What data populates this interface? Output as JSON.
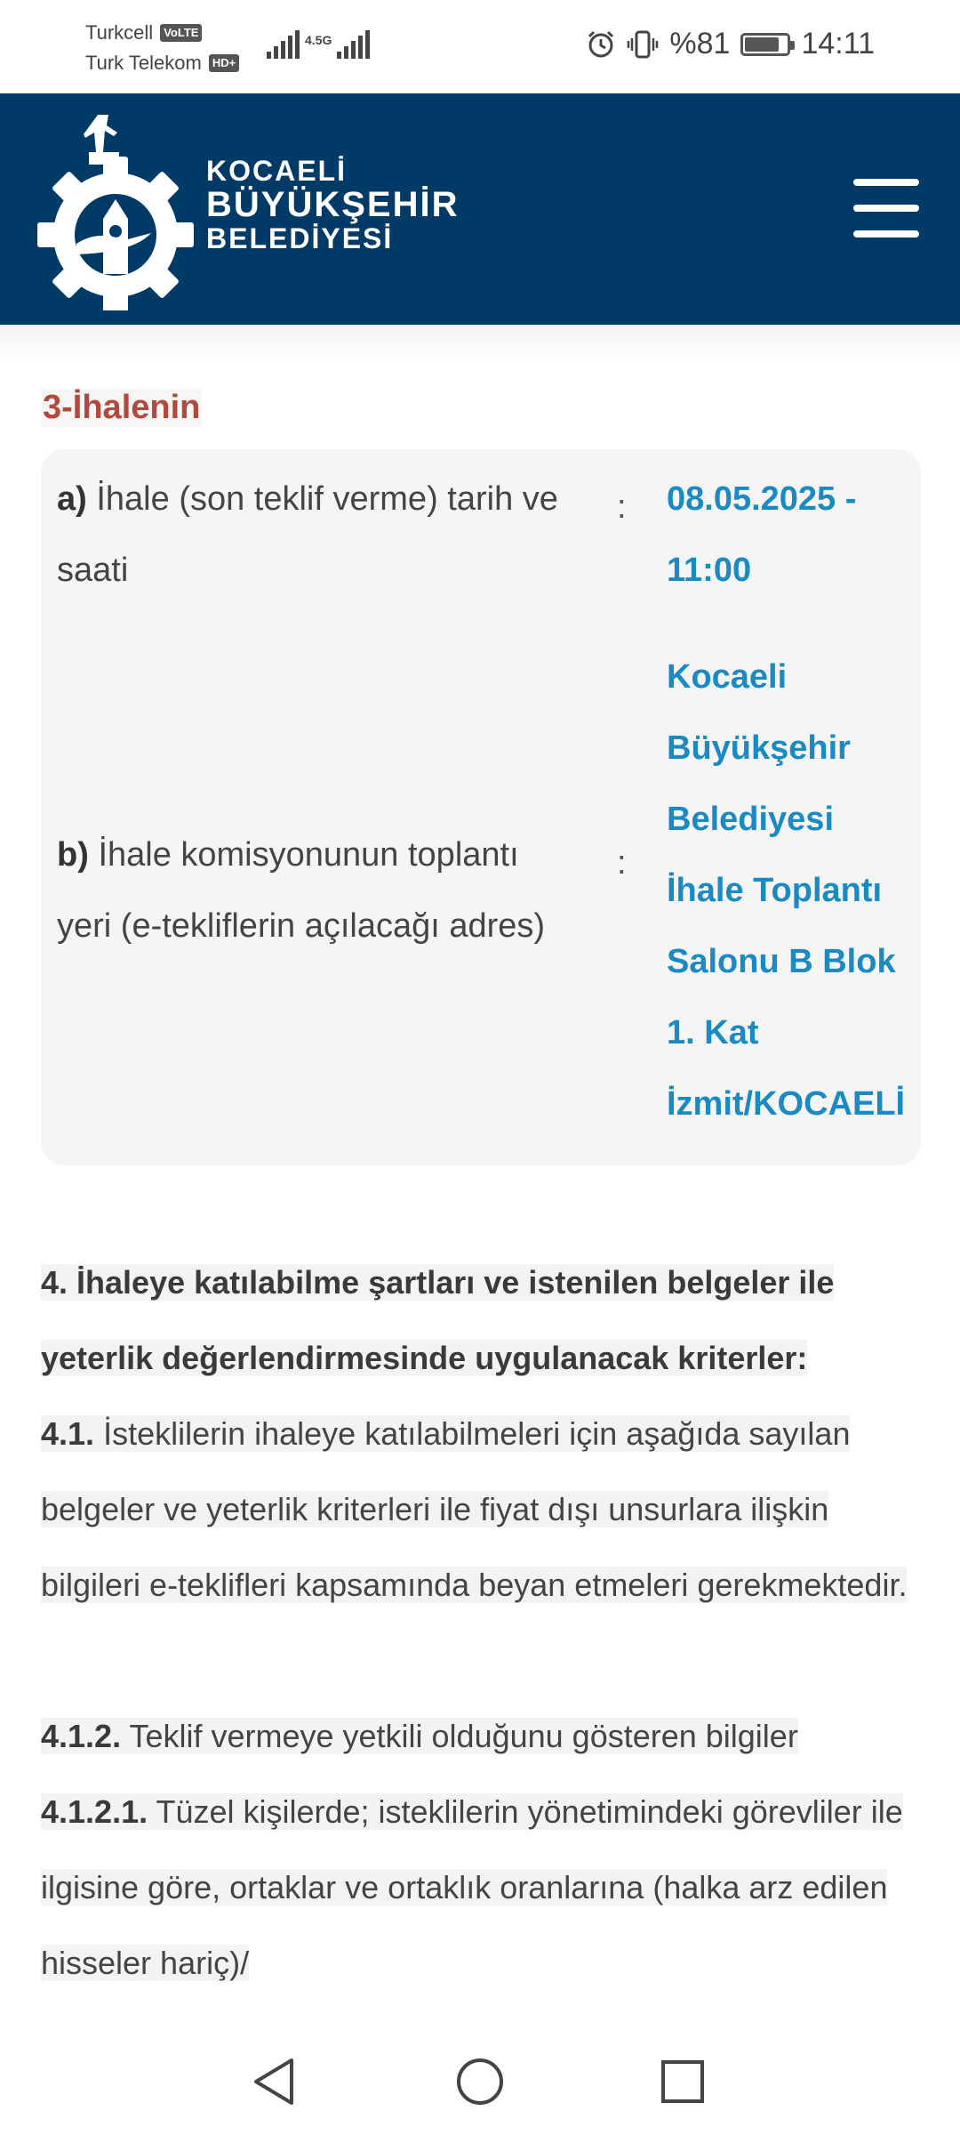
{
  "status_bar": {
    "carrier1": "Turkcell",
    "carrier1_tag": "VoLTE",
    "carrier2": "Turk Telekom",
    "carrier2_tag": "HD+",
    "network": "4.5G",
    "battery_text": "%81",
    "battery_level_percent": 81,
    "time": "14:11"
  },
  "header": {
    "brand_line1": "KOCAELİ",
    "brand_line2": "BÜYÜKŞEHİR",
    "brand_line3": "BELEDİYESİ",
    "logo_icon": "kocaeli-logo-icon",
    "menu_icon": "hamburger-menu-icon",
    "colors": {
      "background": "#003a66",
      "accent_title": "#b14a3c",
      "value_blue": "#1b8ac2"
    }
  },
  "section": {
    "title": "3-İhalenin",
    "rows": [
      {
        "key": "a)",
        "label": "İhale (son teklif verme) tarih ve saati",
        "colon": ":",
        "value": "08.05.2025 - 11:00"
      },
      {
        "key": "b)",
        "label": "İhale komisyonunun toplantı yeri (e-tekliflerin açılacağı adres)",
        "colon": ":",
        "value": "Kocaeli Büyükşehir Belediyesi İhale Toplantı Salonu B Blok 1. Kat İzmit/KOCAELİ"
      }
    ]
  },
  "body": {
    "p4_title": "4. İhaleye katılabilme şartları ve istenilen belgeler ile yeterlik değerlendirmesinde uygulanacak kriterler:",
    "p41_num": "4.1.",
    "p41_text": "İsteklilerin ihaleye katılabilmeleri için aşağıda sayılan belgeler ve yeterlik kriterleri ile fiyat dışı unsurlara ilişkin bilgileri e-teklifleri kapsamında beyan etmeleri gerekmektedir.",
    "p412_num": "4.1.2.",
    "p412_text": "Teklif vermeye yetkili olduğunu gösteren bilgiler",
    "p4121_num": "4.1.2.1.",
    "p4121_text": "Tüzel kişilerde; isteklilerin yönetimindeki görevliler ile ilgisine göre, ortaklar ve ortaklık oranlarına (halka arz edilen hisseler hariç)/"
  },
  "nav": {
    "back_icon": "back-triangle-icon",
    "home_icon": "home-circle-icon",
    "recents_icon": "recents-square-icon"
  }
}
